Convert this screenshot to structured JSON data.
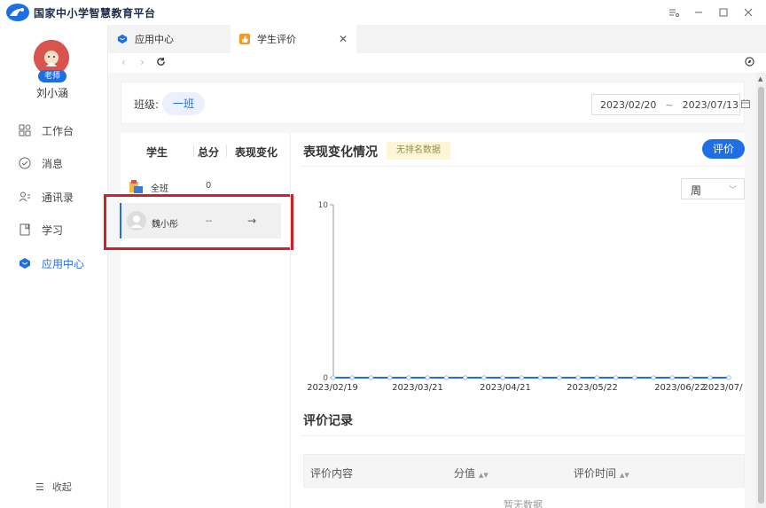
{
  "app": {
    "title": "国家中小学智慧教育平台"
  },
  "user": {
    "role_badge": "老师",
    "name": "刘小涵"
  },
  "sidebar": {
    "items": [
      {
        "label": "工作台",
        "icon": "grid-icon"
      },
      {
        "label": "消息",
        "icon": "check-circle-icon"
      },
      {
        "label": "通讯录",
        "icon": "contacts-icon"
      },
      {
        "label": "学习",
        "icon": "book-icon"
      },
      {
        "label": "应用中心",
        "icon": "app-cube-icon",
        "active": true
      }
    ],
    "collapse_label": "收起"
  },
  "tabs": [
    {
      "label": "应用中心",
      "icon": "app-cube-icon",
      "active": false
    },
    {
      "label": "学生评价",
      "icon": "thumbs-up-icon",
      "active": true
    }
  ],
  "filter": {
    "class_label": "班级:",
    "class_value": "一班",
    "date_start": "2023/02/20",
    "date_sep": "~",
    "date_end": "2023/07/13"
  },
  "student_list": {
    "headers": {
      "student": "学生",
      "total": "总分",
      "change": "表现变化"
    },
    "rows": [
      {
        "name": "全班",
        "score": "0",
        "change": ""
      },
      {
        "name": "魏小彤",
        "score": "--",
        "change": "→"
      }
    ]
  },
  "performance": {
    "title": "表现变化情况",
    "no_rank_tag": "无排名数据",
    "evaluate_button": "评价",
    "period_select": "周"
  },
  "chart_data": {
    "type": "line",
    "title": "",
    "xlabel": "",
    "ylabel": "",
    "ylim": [
      0,
      10
    ],
    "y_ticks": [
      "0",
      "10"
    ],
    "x_tick_labels": [
      "2023/02/19",
      "2023/03/21",
      "2023/04/21",
      "2023/05/22",
      "2023/06/22",
      "2023/07/"
    ],
    "series": [
      {
        "values": [
          0,
          0,
          0,
          0,
          0,
          0,
          0,
          0,
          0,
          0,
          0,
          0,
          0,
          0,
          0,
          0,
          0,
          0,
          0,
          0,
          0,
          0
        ]
      }
    ],
    "color": "#1e6fe6"
  },
  "records": {
    "title": "评价记录",
    "columns": [
      "评价内容",
      "分值",
      "评价时间"
    ],
    "empty_text": "暂无数据"
  }
}
